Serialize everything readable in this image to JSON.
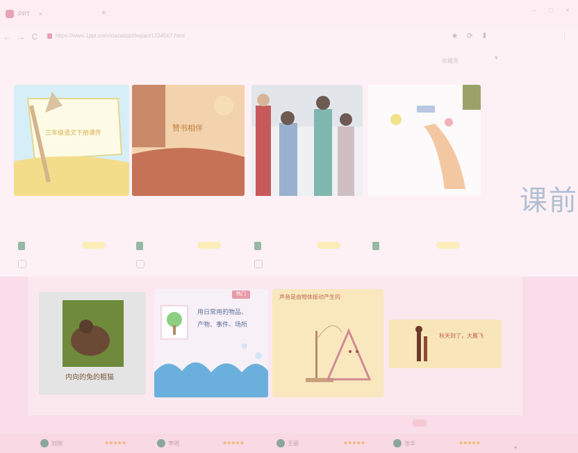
{
  "browser": {
    "tab_title": "PPT",
    "tab_close": "×",
    "new_tab": "+",
    "url": "https://www.1ppt.com/xiazai/ppt/kejian/1234567.html",
    "window_controls": [
      "–",
      "□",
      "×"
    ],
    "back": "←",
    "forward": "→",
    "reload": "C",
    "toolbar_icons": [
      "★",
      "⟳",
      "⬇"
    ],
    "menu": "⋮",
    "toolbar_extra": "收藏夹",
    "toolbar_extra2": "▾"
  },
  "side_text": "课前",
  "row1": {
    "captions": [
      "",
      "",
      "",
      ""
    ],
    "thumb_texts": [
      "",
      "赞书相伴",
      "",
      ""
    ]
  },
  "row2": {
    "thumb5_text": "内向的兔的粗猫",
    "thumb6_lines": [
      "用日常用的物品、",
      "产物、事件、场所"
    ],
    "thumb7_title": "声音是由物体振动产生的",
    "thumb8_title": "秋天到了，大雁飞",
    "badge": "热门",
    "top_text": "",
    "captions": [
      "",
      "",
      "",
      ""
    ]
  },
  "footer": {
    "items": [
      {
        "name": "刘刚",
        "stars": "★★★★★",
        "score": ""
      },
      {
        "name": "李明",
        "stars": "★★★★★",
        "score": ""
      },
      {
        "name": "王丽",
        "stars": "★★★★★",
        "score": ""
      },
      {
        "name": "张华",
        "stars": "★★★★★",
        "score": ""
      }
    ],
    "caret": "▾"
  }
}
